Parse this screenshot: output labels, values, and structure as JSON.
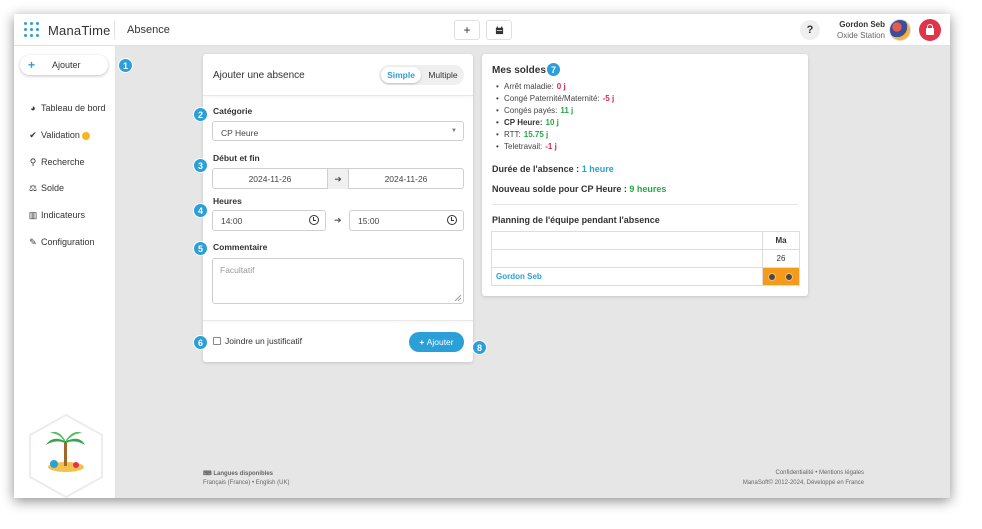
{
  "app": {
    "name": "ManaTime",
    "page": "Absence"
  },
  "topbar": {
    "help": "?",
    "user_name": "Gordon Seb",
    "user_company": "Oxide Station"
  },
  "sidebar": {
    "add_label": "Ajouter",
    "items": [
      {
        "label": "Tableau de bord",
        "icon": "pie-chart-icon"
      },
      {
        "label": "Validation",
        "icon": "check-icon"
      },
      {
        "label": "Recherche",
        "icon": "search-icon"
      },
      {
        "label": "Solde",
        "icon": "scale-icon"
      },
      {
        "label": "Indicateurs",
        "icon": "bar-chart-icon"
      },
      {
        "label": "Configuration",
        "icon": "wrench-icon"
      }
    ]
  },
  "form": {
    "title": "Ajouter une absence",
    "mode_simple": "Simple",
    "mode_multiple": "Multiple",
    "category_label": "Catégorie",
    "category_value": "CP Heure",
    "dates_label": "Début et fin",
    "start_date": "2024-11-26",
    "end_date": "2024-11-26",
    "hours_label": "Heures",
    "start_time": "14:00",
    "end_time": "15:00",
    "comment_label": "Commentaire",
    "comment_placeholder": "Facultatif",
    "attach_label": "Joindre un justificatif",
    "submit_label": "Ajouter"
  },
  "summary": {
    "title": "Mes soldes",
    "balances": [
      {
        "label": "Arrêt maladie:",
        "value": "0 j",
        "tone": "red"
      },
      {
        "label": "Congé Paternité/Maternité:",
        "value": "-5 j",
        "tone": "red"
      },
      {
        "label": "Congés payés:",
        "value": "11 j",
        "tone": "green"
      },
      {
        "label": "CP Heure:",
        "value": "10 j",
        "tone": "green"
      },
      {
        "label": "RTT:",
        "value": "15.75 j",
        "tone": "green"
      },
      {
        "label": "Teletravail:",
        "value": "-1 j",
        "tone": "red"
      }
    ],
    "duration_label": "Durée de l'absence :",
    "duration_value": "1 heure",
    "new_balance_label": "Nouveau solde pour CP Heure :",
    "new_balance_value": "9 heures",
    "planning_title": "Planning de l'équipe pendant l'absence",
    "planning_day": "Ma",
    "planning_date": "26",
    "planning_employee": "Gordon Seb"
  },
  "markers": [
    "1",
    "2",
    "3",
    "4",
    "5",
    "6",
    "7",
    "8"
  ],
  "footer": {
    "lang_title": "Langues disponibles",
    "lang_list": "Français (France) • English (UK)",
    "legal_links": "Confidentialité • Mentions légales",
    "copyright": "ManaSoft© 2012-2024, Développé en France"
  },
  "colors": {
    "accent": "#2a9fd8",
    "danger": "#e0344b",
    "positive": "#28a745",
    "negative": "#d6284b",
    "slot": "#f59a1b"
  }
}
